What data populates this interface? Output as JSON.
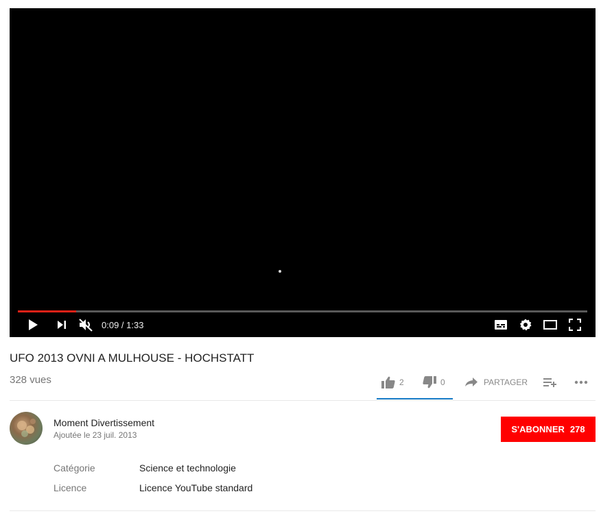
{
  "player": {
    "progress_fraction": 0.102,
    "time_display": "0:09 / 1:33",
    "progress_color": "#e62117"
  },
  "video": {
    "title": "UFO 2013 OVNI A MULHOUSE - HOCHSTATT",
    "views": "328 vues"
  },
  "actions": {
    "likes": "2",
    "dislikes": "0",
    "share_label": "PARTAGER"
  },
  "channel": {
    "name": "Moment Divertissement",
    "published": "Ajoutée le 23 juil. 2013",
    "subscribe_label": "S'ABONNER",
    "subscriber_count": "278",
    "subscribe_color": "#ff0000"
  },
  "metadata": {
    "category_label": "Catégorie",
    "category_value": "Science et technologie",
    "license_label": "Licence",
    "license_value": "Licence YouTube standard"
  },
  "icons": [
    "play-icon",
    "next-icon",
    "volume-muted-icon",
    "subtitles-icon",
    "settings-icon",
    "theater-mode-icon",
    "fullscreen-icon",
    "thumbs-up-icon",
    "thumbs-down-icon",
    "share-icon",
    "add-to-playlist-icon",
    "more-icon"
  ]
}
